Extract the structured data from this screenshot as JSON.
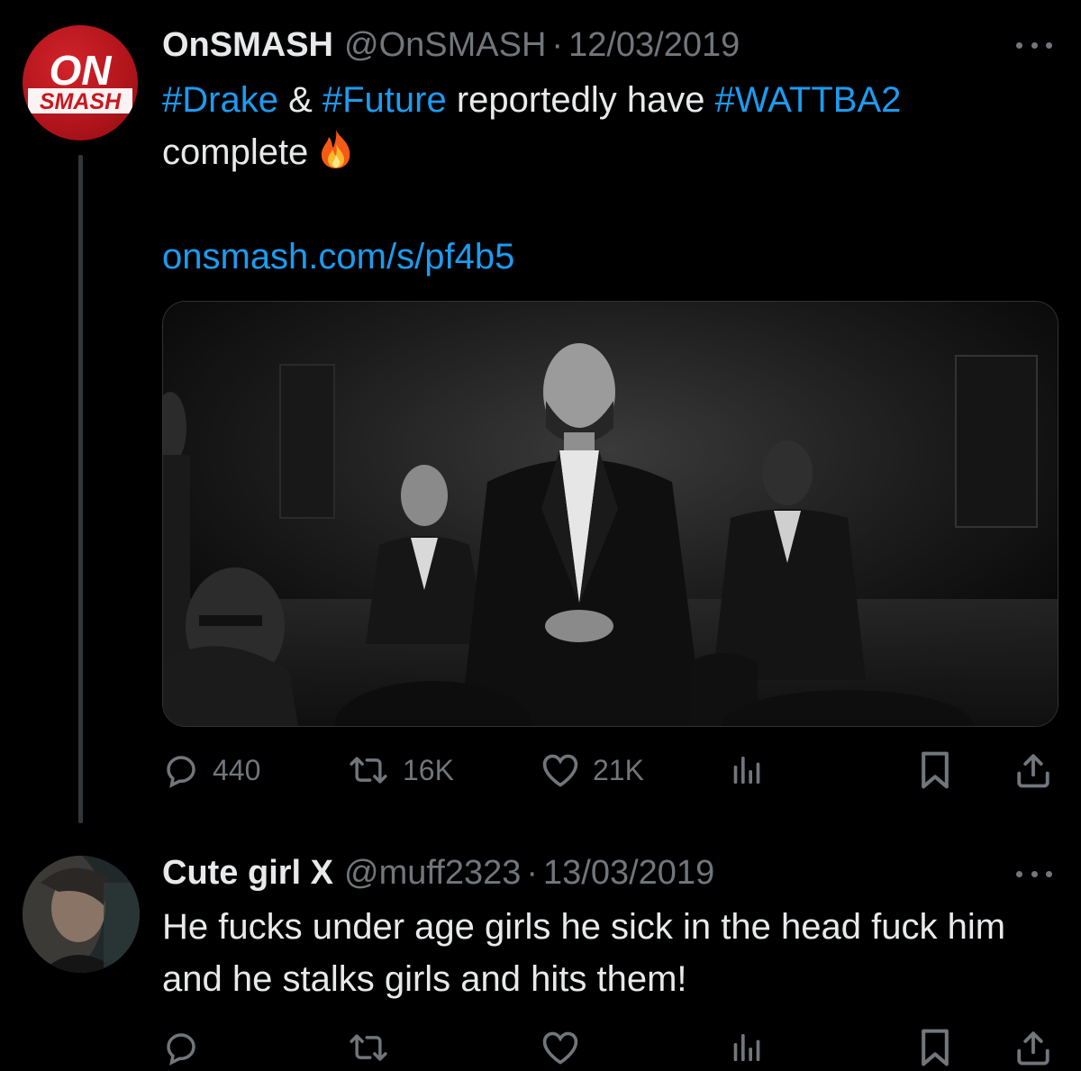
{
  "tweet": {
    "author_name": "OnSMASH",
    "author_handle": "@OnSMASH",
    "separator": "·",
    "date": "12/03/2019",
    "avatar_text_top": "ON",
    "avatar_text_bottom": "SMASH",
    "text_parts": {
      "hashtag1": "#Drake",
      "amp": " & ",
      "hashtag2": "#Future",
      "mid": " reportedly have ",
      "hashtag3": "#WATTBA2",
      "line2": "complete"
    },
    "emoji": "fire-emoji",
    "url": "onsmash.com/s/pf4b5",
    "stats": {
      "replies": "440",
      "retweets": "16K",
      "likes": "21K"
    }
  },
  "reply": {
    "author_name": "Cute girl X",
    "author_handle": "@muff2323",
    "separator": "·",
    "date": "13/03/2019",
    "text": "He fucks under age girls he sick in the head fuck him and he stalks girls and hits them!"
  },
  "colors": {
    "background": "#000000",
    "text": "#e7e9ea",
    "muted": "#71767b",
    "link": "#1d9bf0",
    "brand_red": "#c8181f"
  },
  "icons": [
    "reply-icon",
    "retweet-icon",
    "like-icon",
    "views-icon",
    "bookmark-icon",
    "share-icon",
    "more-icon"
  ]
}
